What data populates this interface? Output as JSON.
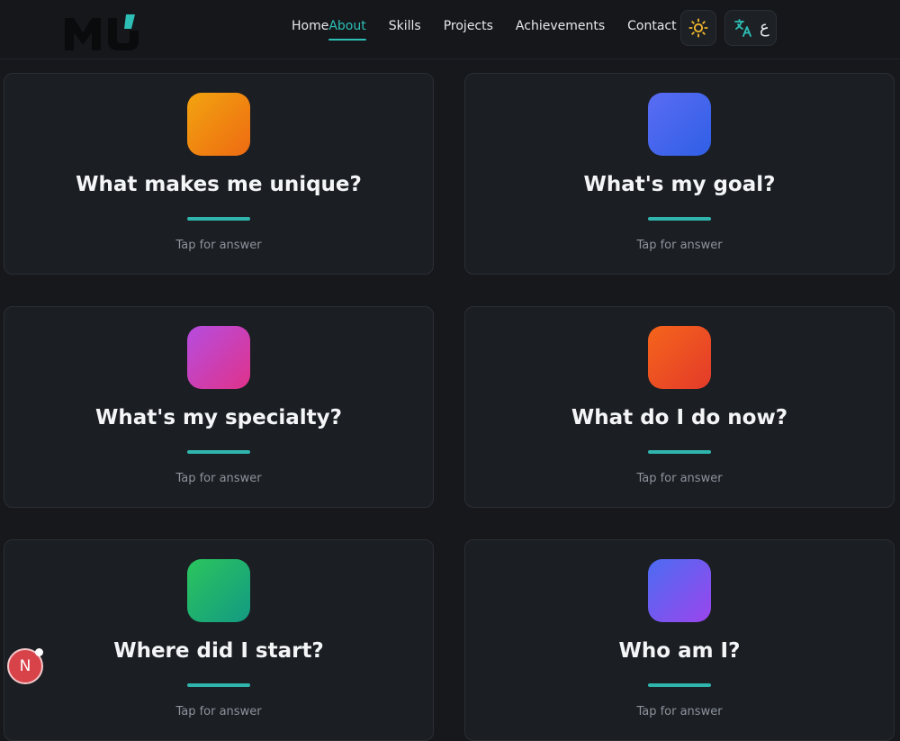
{
  "colors": {
    "accent": "#2dbfb6",
    "background": "#16181c",
    "card": "#1b1e23"
  },
  "nav": {
    "items": [
      {
        "label": "Home",
        "active": false
      },
      {
        "label": "About",
        "active": true
      },
      {
        "label": "Skills",
        "active": false
      },
      {
        "label": "Projects",
        "active": false
      },
      {
        "label": "Achievements",
        "active": false
      },
      {
        "label": "Contact",
        "active": false
      }
    ],
    "theme_icon": "sun-icon",
    "language_icon": "translate-icon",
    "language_code": "ع"
  },
  "cards": [
    {
      "question": "What makes me unique?",
      "hint": "Tap for answer",
      "gradient": [
        "#f2a40f",
        "#ee6a12"
      ]
    },
    {
      "question": "What's my goal?",
      "hint": "Tap for answer",
      "gradient": [
        "#5a6cf3",
        "#2f5fe6"
      ]
    },
    {
      "question": "What's my specialty?",
      "hint": "Tap for answer",
      "gradient": [
        "#b54de0",
        "#e0328a"
      ]
    },
    {
      "question": "What do I do now?",
      "hint": "Tap for answer",
      "gradient": [
        "#f5651b",
        "#e33a2a"
      ]
    },
    {
      "question": "Where did I start?",
      "hint": "Tap for answer",
      "gradient": [
        "#2bc55d",
        "#139a82"
      ]
    },
    {
      "question": "Who am I?",
      "hint": "Tap for answer",
      "gradient": [
        "#4b6cf2",
        "#9b45ec"
      ]
    }
  ],
  "badge": {
    "letter": "N"
  }
}
